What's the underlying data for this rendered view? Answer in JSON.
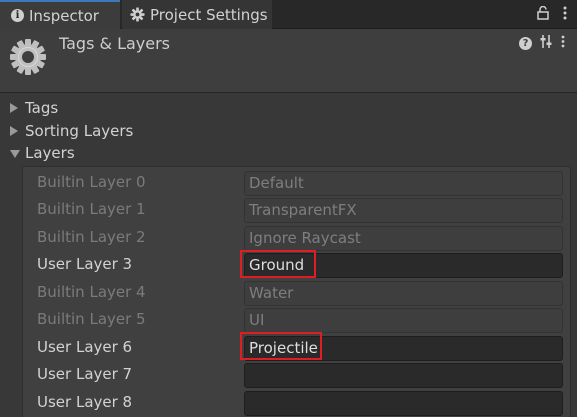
{
  "tabs": {
    "inspector": "Inspector",
    "project_settings": "Project Settings"
  },
  "header": {
    "title": "Tags & Layers"
  },
  "foldouts": {
    "tags": "Tags",
    "sorting_layers": "Sorting Layers",
    "layers": "Layers"
  },
  "layers": [
    {
      "label": "Builtin Layer 0",
      "value": "Default",
      "builtin": true
    },
    {
      "label": "Builtin Layer 1",
      "value": "TransparentFX",
      "builtin": true
    },
    {
      "label": "Builtin Layer 2",
      "value": "Ignore Raycast",
      "builtin": true
    },
    {
      "label": "User Layer 3",
      "value": "Ground",
      "builtin": false
    },
    {
      "label": "Builtin Layer 4",
      "value": "Water",
      "builtin": true
    },
    {
      "label": "Builtin Layer 5",
      "value": "UI",
      "builtin": true
    },
    {
      "label": "User Layer 6",
      "value": "Projectile",
      "builtin": false
    },
    {
      "label": "User Layer 7",
      "value": "",
      "builtin": false
    },
    {
      "label": "User Layer 8",
      "value": "",
      "builtin": false
    }
  ],
  "icons": {
    "inspector_tab": "info-icon",
    "project_settings_tab": "gear-icon",
    "lock": "lock-icon",
    "menu": "kebab-menu-icon",
    "header": "settings-gear-icon",
    "help": "help-icon",
    "presets": "presets-icon"
  },
  "colors": {
    "active_tab_accent": "#3a79bb",
    "highlight": "#e01c24",
    "background": "#383838"
  }
}
